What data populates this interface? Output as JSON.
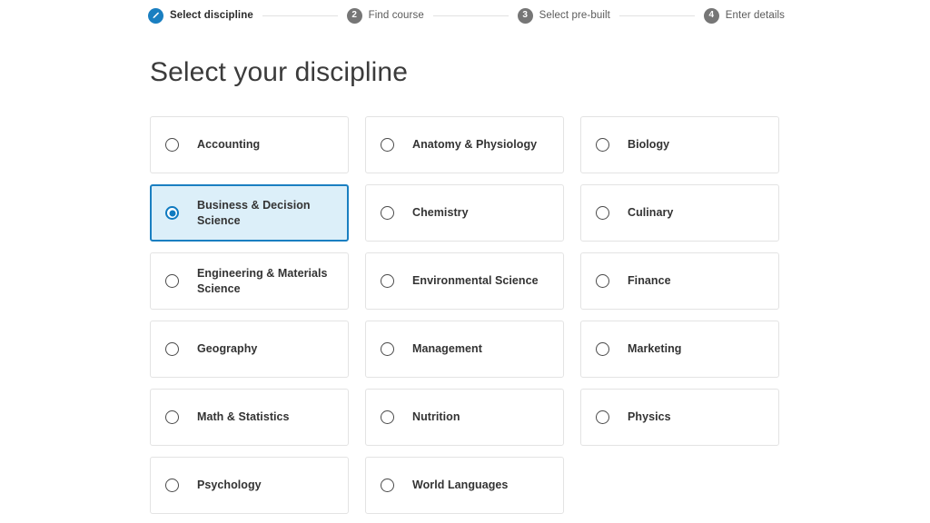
{
  "stepper": {
    "steps": [
      {
        "label": "Select discipline",
        "badge": "pencil-icon",
        "state": "active"
      },
      {
        "label": "Find course",
        "badge": "2",
        "state": "inactive"
      },
      {
        "label": "Select pre-built",
        "badge": "3",
        "state": "inactive"
      },
      {
        "label": "Enter details",
        "badge": "4",
        "state": "inactive"
      }
    ]
  },
  "page": {
    "title": "Select your discipline"
  },
  "colors": {
    "accent": "#1a7fc1",
    "selected_fill": "#dceff9",
    "inactive_badge": "#767676",
    "card_border": "#e3e3e3",
    "text": "#333333"
  },
  "disciplines": [
    {
      "label": "Accounting",
      "selected": false
    },
    {
      "label": "Anatomy & Physiology",
      "selected": false
    },
    {
      "label": "Biology",
      "selected": false
    },
    {
      "label": "Business & Decision Science",
      "selected": true
    },
    {
      "label": "Chemistry",
      "selected": false
    },
    {
      "label": "Culinary",
      "selected": false
    },
    {
      "label": "Engineering & Materials Science",
      "selected": false
    },
    {
      "label": "Environmental Science",
      "selected": false
    },
    {
      "label": "Finance",
      "selected": false
    },
    {
      "label": "Geography",
      "selected": false
    },
    {
      "label": "Management",
      "selected": false
    },
    {
      "label": "Marketing",
      "selected": false
    },
    {
      "label": "Math & Statistics",
      "selected": false
    },
    {
      "label": "Nutrition",
      "selected": false
    },
    {
      "label": "Physics",
      "selected": false
    },
    {
      "label": "Psychology",
      "selected": false
    },
    {
      "label": "World Languages",
      "selected": false
    }
  ]
}
